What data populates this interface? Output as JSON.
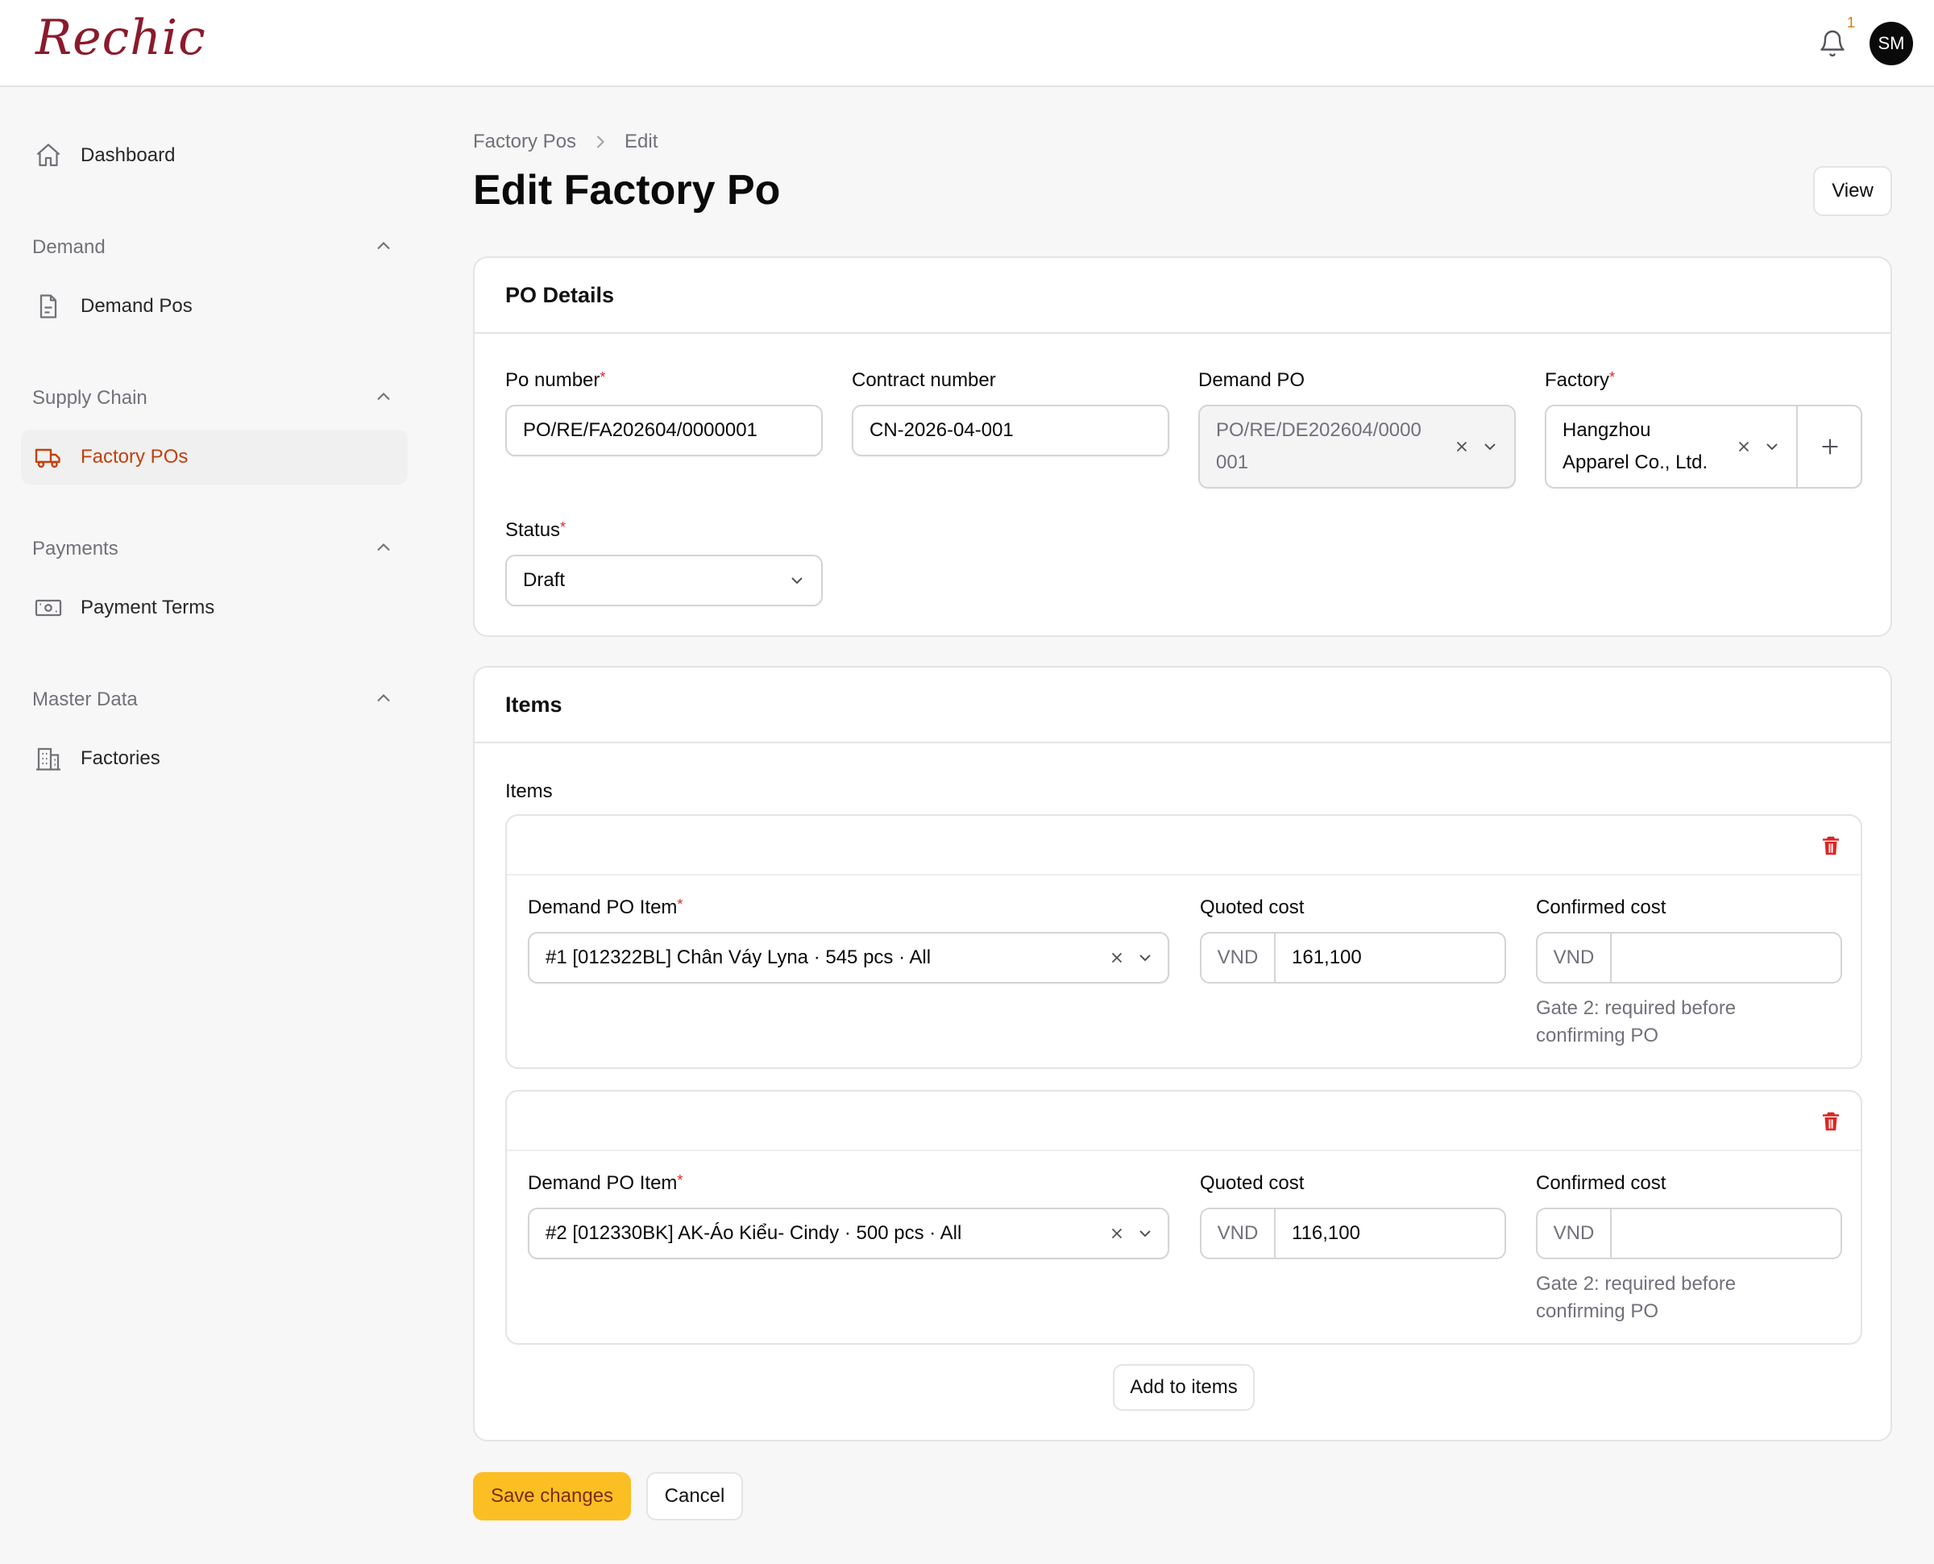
{
  "app": {
    "logo": "Rechic"
  },
  "header": {
    "notification_count": "1",
    "avatar_initials": "SM"
  },
  "sidebar": {
    "dashboard": "Dashboard",
    "groups": [
      {
        "title": "Demand",
        "items": [
          "Demand Pos"
        ]
      },
      {
        "title": "Supply Chain",
        "items": [
          "Factory POs"
        ]
      },
      {
        "title": "Payments",
        "items": [
          "Payment Terms"
        ]
      },
      {
        "title": "Master Data",
        "items": [
          "Factories"
        ]
      }
    ],
    "active_item": "Factory POs"
  },
  "breadcrumb": {
    "parent": "Factory Pos",
    "current": "Edit"
  },
  "page": {
    "title": "Edit Factory Po",
    "view_button": "View"
  },
  "po_details": {
    "title": "PO Details",
    "po_number": {
      "label": "Po number",
      "value": "PO/RE/FA202604/0000001"
    },
    "contract_number": {
      "label": "Contract number",
      "value": "CN-2026-04-001"
    },
    "demand_po": {
      "label": "Demand PO",
      "value_line1": "PO/RE/DE202604/0000",
      "value_line2": "001"
    },
    "factory": {
      "label": "Factory",
      "value_line1": "Hangzhou",
      "value_line2": "Apparel Co., Ltd."
    },
    "status": {
      "label": "Status",
      "value": "Draft"
    }
  },
  "items_section": {
    "title": "Items",
    "subtitle": "Items",
    "demand_item_label": "Demand PO Item",
    "quoted_label": "Quoted cost",
    "confirmed_label": "Confirmed cost",
    "currency": "VND",
    "hint": "Gate 2: required before confirming PO",
    "rows": [
      {
        "demand_item": "#1 [012322BL] Chân Váy Lyna · 545 pcs · All",
        "quoted": "161,100",
        "confirmed": ""
      },
      {
        "demand_item": "#2 [012330BK] AK-Áo Kiểu- Cindy · 500 pcs · All",
        "quoted": "116,100",
        "confirmed": ""
      }
    ],
    "add_button": "Add to items"
  },
  "actions": {
    "save": "Save changes",
    "cancel": "Cancel"
  }
}
